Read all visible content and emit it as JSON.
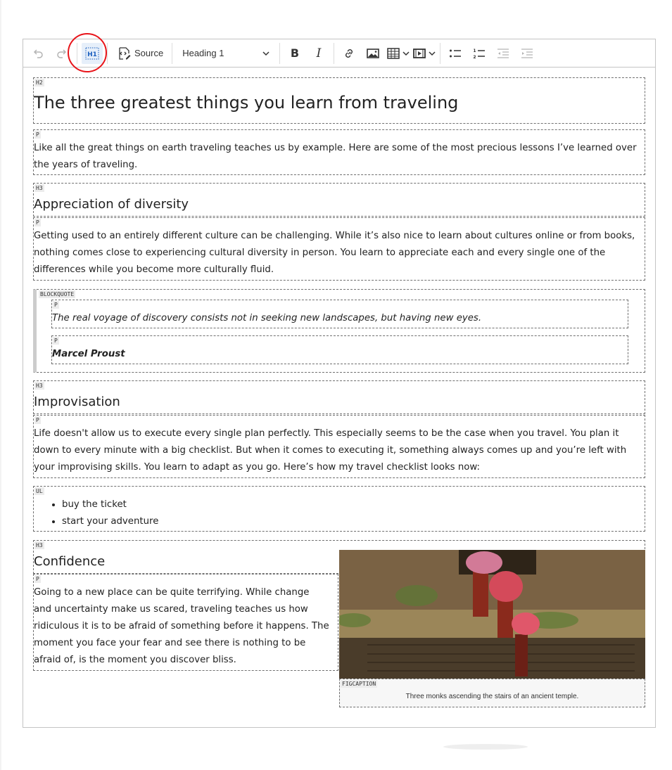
{
  "toolbar": {
    "undo": "undo-icon",
    "redo": "redo-icon",
    "show_blocks": {
      "label": "H1",
      "icon": "show-blocks-icon",
      "active": true
    },
    "source_label": "Source",
    "heading_select": "Heading 1",
    "buttons": [
      "bold",
      "italic",
      "link",
      "image",
      "table",
      "media",
      "bulleted-list",
      "numbered-list",
      "outdent",
      "indent"
    ]
  },
  "content": {
    "blocks": [
      {
        "tag": "H2",
        "text": "The three greatest things you learn from traveling"
      },
      {
        "tag": "P",
        "text": "Like all the great things on earth traveling teaches us by example. Here are some of the most precious lessons I’ve learned over the years of traveling."
      },
      {
        "tag": "H3",
        "text": "Appreciation of diversity"
      },
      {
        "tag": "P",
        "text": "Getting used to an entirely different culture can be challenging. While it’s also nice to learn about cultures online or from books, nothing comes close to experiencing cultural diversity in person. You learn to appreciate each and every single one of the differences while you become more culturally fluid."
      },
      {
        "tag": "BLOCKQUOTE",
        "quote_tag": "P",
        "quote": "The real voyage of discovery consists not in seeking new landscapes, but having new eyes.",
        "author_tag": "P",
        "author": "Marcel Proust"
      },
      {
        "tag": "H3",
        "text": "Improvisation"
      },
      {
        "tag": "P",
        "text": "Life doesn't allow us to execute every single plan perfectly. This especially seems to be the case when you travel. You plan it down to every minute with a big checklist. But when it comes to executing it, something always comes up and you’re left with your improvising skills. You learn to adapt as you go. Here’s how my travel checklist looks now:"
      },
      {
        "tag": "UL",
        "items": [
          "buy the ticket",
          "start your adventure"
        ]
      },
      {
        "tag": "H3",
        "text": "Confidence"
      },
      {
        "tag": "P",
        "text": "Going to a new place can be quite terrifying. While change and uncertainty make us scared, traveling teaches us how ridiculous it is to be afraid of something before it happens. The moment you face your fear and see there is nothing to be afraid of, is the moment you discover bliss."
      }
    ],
    "figure": {
      "image": "monks-with-umbrellas-photo",
      "caption_tag": "FIGCAPTION",
      "caption": "Three monks ascending the stairs of an ancient temple."
    }
  }
}
